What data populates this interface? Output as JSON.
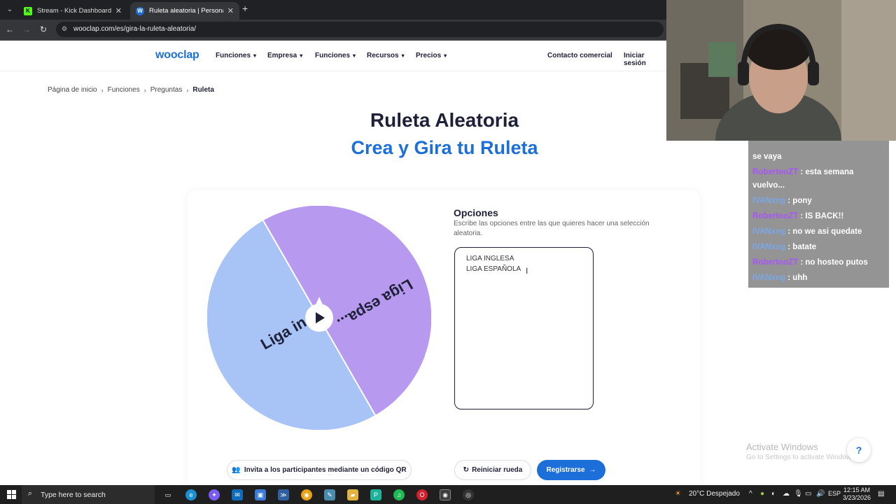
{
  "browser": {
    "tabs": [
      {
        "title": "Stream - Kick Dashboard",
        "favicon": "K"
      },
      {
        "title": "Ruleta aleatoria | Personaliza y g",
        "favicon": "W"
      }
    ],
    "url": "wooclap.com/es/gira-la-ruleta-aleatoria/"
  },
  "header": {
    "logo": "wooclap",
    "nav": [
      "Funciones",
      "Empresa",
      "Funciones",
      "Recursos",
      "Precios"
    ],
    "contact": "Contacto comercial",
    "login": "Iniciar sesión"
  },
  "breadcrumb": [
    "Página de inicio",
    "Funciones",
    "Preguntas",
    "Ruleta"
  ],
  "hero": {
    "title": "Ruleta Aleatoria",
    "subtitle": "Crea y Gira tu Ruleta"
  },
  "wheel": {
    "segments": [
      {
        "label": "Liga ingl...",
        "color": "#a8c4f7"
      },
      {
        "label": "Liga espa...",
        "color": "#b799f0"
      }
    ]
  },
  "options": {
    "title": "Opciones",
    "description": "Escribe las opciones entre las que quieres hacer una selección aleatoria.",
    "lines": [
      "LIGA INGLESA",
      "LIGA ESPAÑOLA"
    ]
  },
  "buttons": {
    "qr": "Invita a los participantes mediante un código QR",
    "reset": "Reiniciar rueda",
    "register": "Registrarse"
  },
  "chat": [
    {
      "user": "",
      "message": "se vaya",
      "color": "none"
    },
    {
      "user": "RobertooZT",
      "message": ": esta semana vuelvo...",
      "color": "purple"
    },
    {
      "user": "IVANxng",
      "message": ": pony",
      "color": "blue"
    },
    {
      "user": "RobertooZT",
      "message": ": IS BACK!!",
      "color": "purple"
    },
    {
      "user": "IVANxng",
      "message": ": no we asi quedate",
      "color": "blue"
    },
    {
      "user": "IVANxng",
      "message": ": batate",
      "color": "blue"
    },
    {
      "user": "RobertooZT",
      "message": ": no hosteo putos",
      "color": "purple"
    },
    {
      "user": "IVANxng",
      "message": ": uhh",
      "color": "blue"
    }
  ],
  "watermark": {
    "title": "Activate Windows",
    "subtitle": "Go to Settings to activate Windows."
  },
  "taskbar": {
    "search_placeholder": "Type here to search",
    "weather": "20°C  Despejado",
    "lang": "ESP",
    "time": "12:15 AM",
    "date": "3/23/2026"
  },
  "colors": {
    "brand_blue": "#1c6fd9",
    "dark_navy": "#1e2038",
    "wheel_blue": "#a8c4f7",
    "wheel_purple": "#b799f0"
  }
}
